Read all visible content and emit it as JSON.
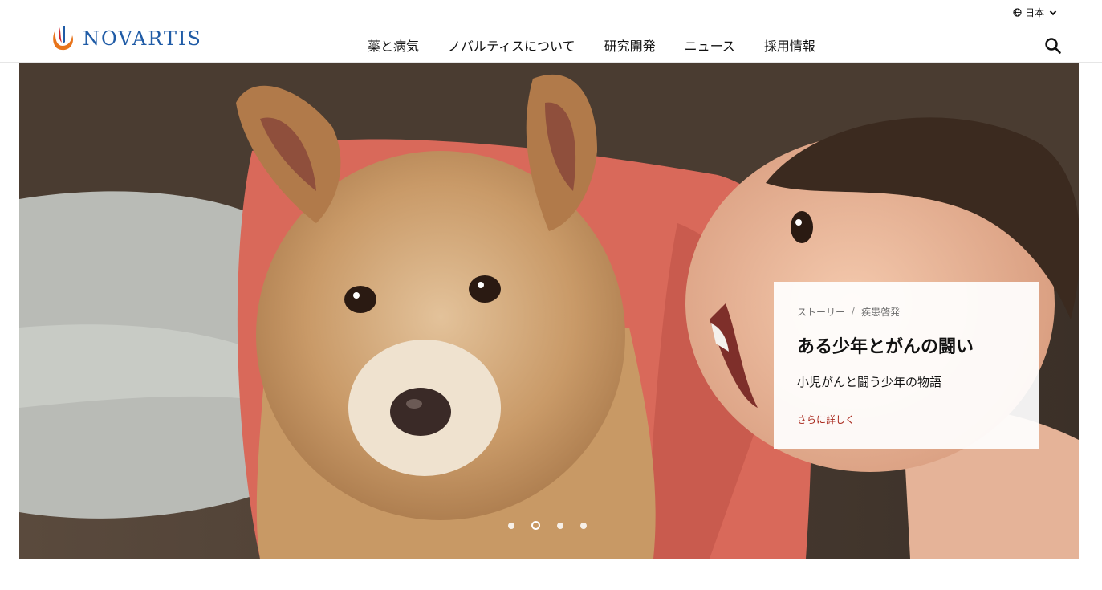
{
  "header": {
    "brand": "NOVARTIS",
    "language": "日本",
    "nav": [
      {
        "label": "薬と病気"
      },
      {
        "label": "ノバルティスについて"
      },
      {
        "label": "研究開発"
      },
      {
        "label": "ニュース"
      },
      {
        "label": "採用情報"
      }
    ],
    "icons": {
      "search": "search-icon",
      "language": "globe-icon",
      "dropdown": "chevron-down-icon"
    }
  },
  "hero": {
    "crumb_primary": "ストーリー",
    "crumb_separator": "/",
    "crumb_secondary": "疾患啓発",
    "title": "ある少年とがんの闘い",
    "subtitle": "小児がんと闘う少年の物語",
    "link": "さらに詳しく",
    "slides_total": 4,
    "active_slide": 2
  },
  "colors": {
    "brand_blue": "#1f5ba6",
    "link_red": "#a8281c",
    "logo_orange": "#e8741b",
    "logo_red": "#d1282e"
  }
}
